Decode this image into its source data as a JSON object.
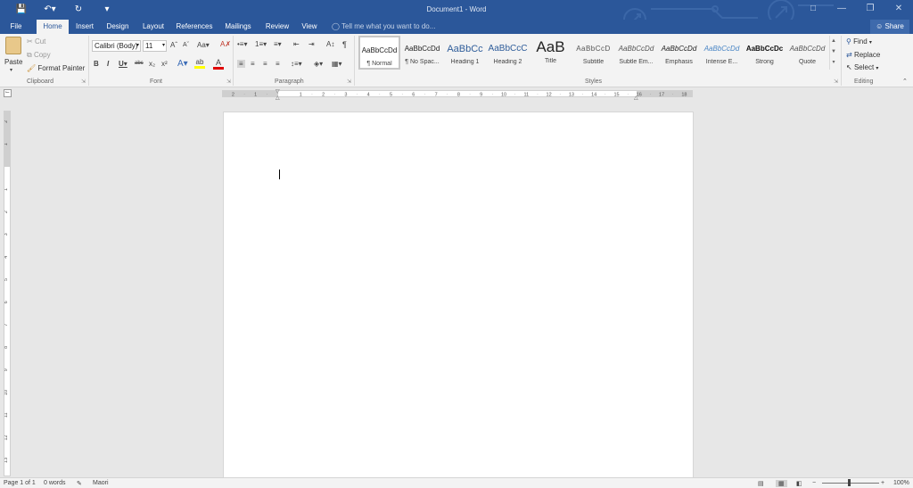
{
  "window": {
    "title": "Document1 - Word",
    "qat": {
      "save": "save",
      "undo": "undo",
      "redo": "redo",
      "customize": "customize"
    }
  },
  "tabs": [
    {
      "label": "File"
    },
    {
      "label": "Home"
    },
    {
      "label": "Insert"
    },
    {
      "label": "Design"
    },
    {
      "label": "Layout"
    },
    {
      "label": "References"
    },
    {
      "label": "Mailings"
    },
    {
      "label": "Review"
    },
    {
      "label": "View"
    }
  ],
  "tell_me": "Tell me what you want to do...",
  "share_label": "Share",
  "clipboard": {
    "paste": "Paste",
    "cut": "Cut",
    "copy": "Copy",
    "format_painter": "Format Painter",
    "group_label": "Clipboard"
  },
  "font": {
    "family": "Calibri (Body)",
    "size": "11",
    "group_label": "Font"
  },
  "paragraph": {
    "group_label": "Paragraph"
  },
  "styles": {
    "group_label": "Styles",
    "items": [
      {
        "preview": "AaBbCcDd",
        "name": "¶ Normal"
      },
      {
        "preview": "AaBbCcDd",
        "name": "¶ No Spac..."
      },
      {
        "preview": "AaBbCc",
        "name": "Heading 1"
      },
      {
        "preview": "AaBbCcC",
        "name": "Heading 2"
      },
      {
        "preview": "AaB",
        "name": "Title"
      },
      {
        "preview": "AaBbCcD",
        "name": "Subtitle"
      },
      {
        "preview": "AaBbCcDd",
        "name": "Subtle Em..."
      },
      {
        "preview": "AaBbCcDd",
        "name": "Emphasis"
      },
      {
        "preview": "AaBbCcDd",
        "name": "Intense E..."
      },
      {
        "preview": "AaBbCcDc",
        "name": "Strong"
      },
      {
        "preview": "AaBbCcDd",
        "name": "Quote"
      }
    ]
  },
  "editing": {
    "find": "Find",
    "replace": "Replace",
    "select": "Select",
    "group_label": "Editing"
  },
  "ruler": {
    "h_ticks": [
      "2",
      "1",
      "1",
      "2",
      "3",
      "4",
      "5",
      "6",
      "7",
      "8",
      "9",
      "10",
      "11",
      "12",
      "13",
      "14",
      "15",
      "16",
      "17",
      "18"
    ],
    "v_ticks": [
      "2",
      "1",
      "1",
      "2",
      "3",
      "4",
      "5",
      "6",
      "7",
      "8",
      "9",
      "10",
      "11",
      "12",
      "13"
    ]
  },
  "status": {
    "page": "Page 1 of 1",
    "words": "0 words",
    "language": "Maori",
    "zoom": "100%"
  },
  "colors": {
    "accent": "#2b579a",
    "highlight": "#ffff00",
    "font_color": "#e00000"
  }
}
